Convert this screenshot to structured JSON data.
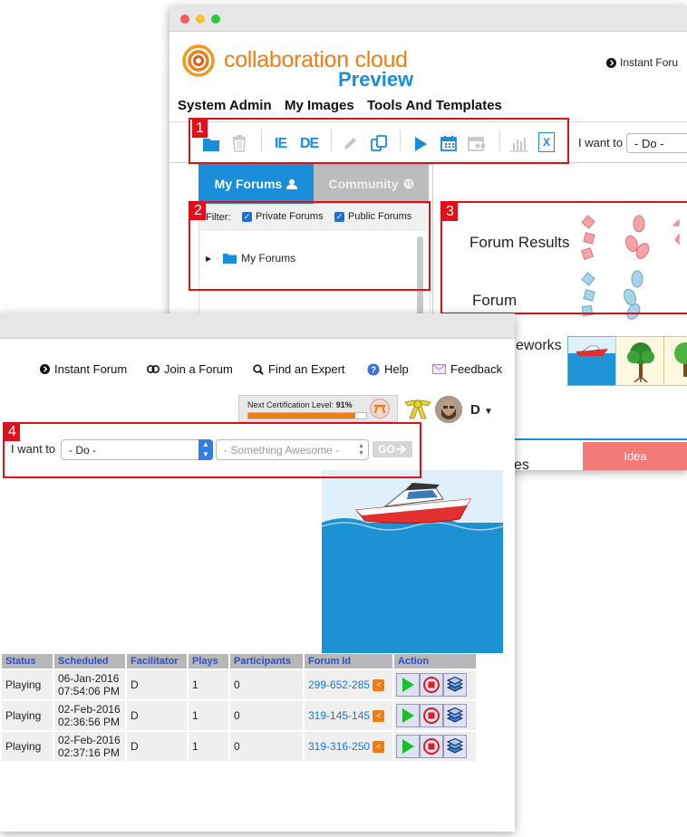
{
  "back_window": {
    "logo_text": "collaboration cloud",
    "logo_sub": "Preview",
    "header_link": "Instant Foru",
    "menu": [
      "System Admin",
      "My Images",
      "Tools And Templates"
    ],
    "toolbar": {
      "icons": [
        "folder-icon",
        "trash-icon",
        "ie-icon",
        "de-icon",
        "pencil-icon",
        "copy-icon",
        "play-icon",
        "calendar-icon",
        "calendar-people-icon",
        "bar-chart-icon",
        "excel-icon"
      ],
      "ie_label": "IE",
      "de_label": "DE",
      "excel_label": "X",
      "i_want_to": "I want to",
      "do_select": "- Do -"
    },
    "tabs": {
      "my_forums": "My Forums",
      "community": "Community"
    },
    "filter": {
      "label": "Filter:",
      "private": "Private Forums",
      "public": "Public Forums"
    },
    "tree": {
      "my_forums": "My Forums"
    },
    "canvas_labels": {
      "forum_results": "Forum Results",
      "forum": "Forum",
      "frameworks": "eworks",
      "cut_text": "es"
    },
    "idea_button": "Idea"
  },
  "annotations": [
    "1",
    "2",
    "3",
    "4"
  ],
  "front_window": {
    "nav": {
      "instant_forum": "Instant Forum",
      "join_forum": "Join a Forum",
      "find_expert": "Find an Expert",
      "help": "Help",
      "feedback": "Feedback"
    },
    "certification": {
      "label": "Next Certification Level:",
      "percent": "91%",
      "progress": 0.91
    },
    "user_initial": "D",
    "i_want_to": "I want to",
    "do_select": "- Do -",
    "something_select": "- Something Awesome -",
    "go_label": "GO",
    "table": {
      "headers": [
        "Status",
        "Scheduled",
        "Facilitator",
        "Plays",
        "Participants",
        "Forum Id",
        "Action"
      ],
      "rows": [
        {
          "status": "Playing",
          "date": "06-Jan-2016",
          "time": "07:54:06 PM",
          "facilitator": "D",
          "plays": "1",
          "participants": "0",
          "forum_id": "299-652-285"
        },
        {
          "status": "Playing",
          "date": "02-Feb-2016",
          "time": "02:36:56 PM",
          "facilitator": "D",
          "plays": "1",
          "participants": "0",
          "forum_id": "319-145-145"
        },
        {
          "status": "Playing",
          "date": "02-Feb-2016",
          "time": "02:37:16 PM",
          "facilitator": "D",
          "plays": "1",
          "participants": "0",
          "forum_id": "319-316-250"
        }
      ]
    }
  },
  "colors": {
    "accent_blue": "#1a8ed8",
    "brand_orange": "#f07d14",
    "annotation_red": "#e0101a",
    "link_blue": "#1a78c8"
  }
}
